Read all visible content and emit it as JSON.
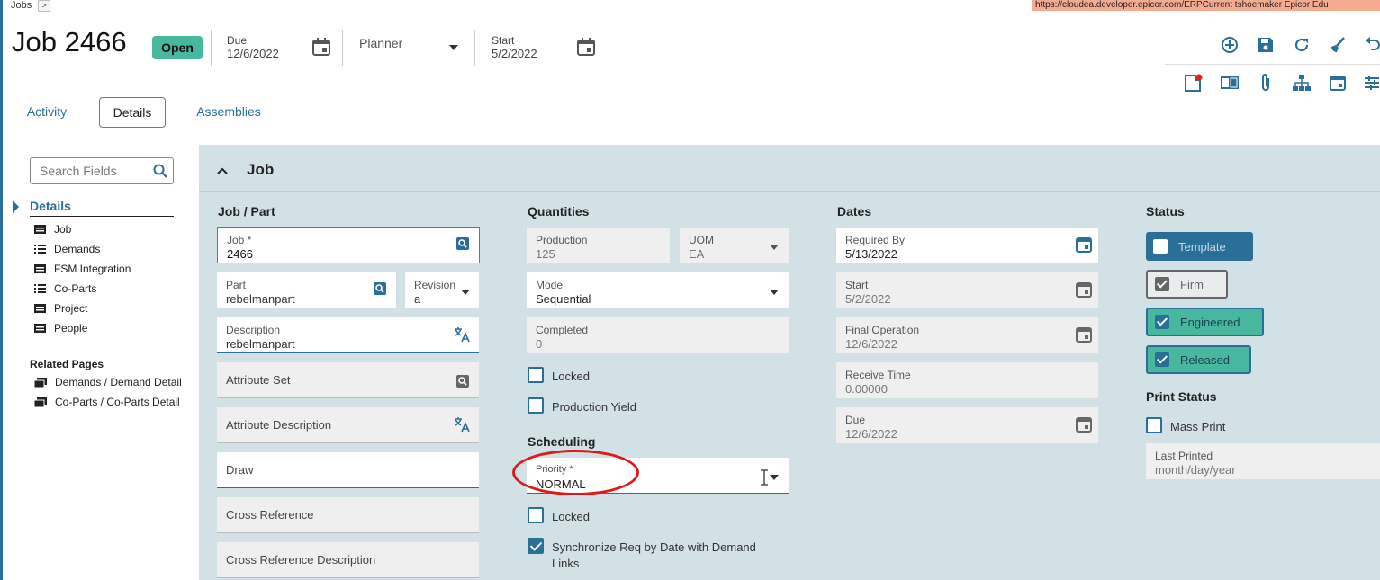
{
  "breadcrumb": {
    "label": "Jobs",
    "arrow": ">"
  },
  "url_bar": {
    "text": "https://cloudea.developer.epicor.com/ERPCurrent   tshoemaker   Epicor Edu"
  },
  "header": {
    "title": "Job 2466",
    "status_badge": "Open",
    "due": {
      "label": "Due",
      "value": "12/6/2022"
    },
    "planner": {
      "label": "Planner"
    },
    "start": {
      "label": "Start",
      "value": "5/2/2022"
    }
  },
  "toolbar": {
    "row1": [
      "add-new-icon",
      "save-icon",
      "refresh-icon",
      "clear-icon",
      "undo-icon"
    ],
    "row2": [
      "memo-icon",
      "book-icon",
      "attachment-icon",
      "hierarchy-icon",
      "calendar-icon",
      "settings-icon"
    ]
  },
  "tabs": [
    {
      "label": "Activity",
      "active": false
    },
    {
      "label": "Details",
      "active": true
    },
    {
      "label": "Assemblies",
      "active": false
    }
  ],
  "sidebar": {
    "search_placeholder": "Search Fields",
    "section_title": "Details",
    "items": [
      {
        "label": "Job",
        "icon": "panel-icon"
      },
      {
        "label": "Demands",
        "icon": "list-icon"
      },
      {
        "label": "FSM Integration",
        "icon": "panel-icon"
      },
      {
        "label": "Co-Parts",
        "icon": "list-icon"
      },
      {
        "label": "Project",
        "icon": "panel-icon"
      },
      {
        "label": "People",
        "icon": "panel-icon"
      }
    ],
    "related_title": "Related Pages",
    "related": [
      {
        "label": "Demands / Demand Detail",
        "icon": "pages-icon"
      },
      {
        "label": "Co-Parts / Co-Parts Detail",
        "icon": "pages-icon"
      }
    ]
  },
  "section": {
    "title": "Job",
    "job_part": {
      "heading": "Job / Part",
      "job": {
        "label": "Job *",
        "value": "2466"
      },
      "part": {
        "label": "Part",
        "value": "rebelmanpart"
      },
      "revision": {
        "label": "Revision",
        "value": "a"
      },
      "description": {
        "label": "Description",
        "value": "rebelmanpart"
      },
      "attribute_set": "Attribute Set",
      "attribute_description": "Attribute Description",
      "draw": "Draw",
      "cross_reference": "Cross Reference",
      "cross_reference_description": "Cross Reference Description"
    },
    "quantities": {
      "heading": "Quantities",
      "production": {
        "label": "Production",
        "value": "125"
      },
      "uom": {
        "label": "UOM",
        "value": "EA"
      },
      "mode": {
        "label": "Mode",
        "value": "Sequential"
      },
      "completed": {
        "label": "Completed",
        "value": "0"
      },
      "locked": {
        "label": "Locked",
        "checked": false
      },
      "production_yield": {
        "label": "Production Yield",
        "checked": false
      },
      "scheduling_heading": "Scheduling",
      "priority": {
        "label": "Priority *",
        "value": "NORMAL"
      },
      "sched_locked": {
        "label": "Locked",
        "checked": false
      },
      "sync_req": {
        "label_line1": "Synchronize Req by Date with Demand",
        "label_line2": "Links",
        "checked": true
      }
    },
    "dates": {
      "heading": "Dates",
      "required_by": {
        "label": "Required By",
        "value": "5/13/2022"
      },
      "start": {
        "label": "Start",
        "value": "5/2/2022"
      },
      "final_operation": {
        "label": "Final Operation",
        "value": "12/6/2022"
      },
      "receive_time": {
        "label": "Receive Time",
        "value": "0.00000"
      },
      "due": {
        "label": "Due",
        "value": "12/6/2022"
      }
    },
    "status": {
      "heading": "Status",
      "template": {
        "label": "Template",
        "checked": false
      },
      "firm": {
        "label": "Firm",
        "checked": true
      },
      "engineered": {
        "label": "Engineered",
        "checked": true
      },
      "released": {
        "label": "Released",
        "checked": true
      },
      "print_heading": "Print Status",
      "mass_print": {
        "label": "Mass Print",
        "checked": false
      },
      "last_printed": {
        "label": "Last Printed",
        "placeholder": "month/day/year"
      }
    }
  },
  "colors": {
    "accent": "#2a6f97",
    "open_badge": "#47b89d",
    "panel_bg": "#d2e1e5",
    "highlight": "#e01818"
  }
}
